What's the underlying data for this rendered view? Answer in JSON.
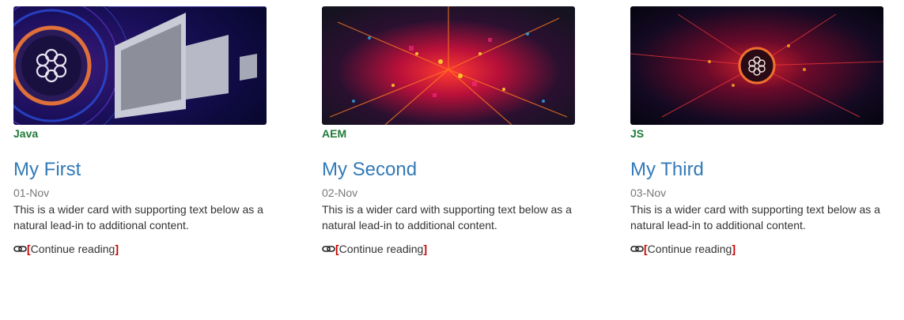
{
  "cards": [
    {
      "image_icon": "adobe-experience-manager-logo-with-tablets",
      "category": "Java",
      "title": "My First",
      "date": "01-Nov",
      "description": "This is a wider card with supporting text below as a natural lead-in to additional content.",
      "link_icon": "chain-link-icon",
      "read_more_open": "[",
      "read_more_label": "Continue reading",
      "read_more_close": "]"
    },
    {
      "image_icon": "circuit-board-red-lights",
      "category": "AEM",
      "title": "My Second",
      "date": "02-Nov",
      "description": "This is a wider card with supporting text below as a natural lead-in to additional content.",
      "link_icon": "chain-link-icon",
      "read_more_open": "[",
      "read_more_label": "Continue reading",
      "read_more_close": "]"
    },
    {
      "image_icon": "adobe-experience-manager-logo-on-circuit",
      "category": "JS",
      "title": "My Third",
      "date": "03-Nov",
      "description": "This is a wider card with supporting text below as a natural lead-in to additional content.",
      "link_icon": "chain-link-icon",
      "read_more_open": "[",
      "read_more_label": "Continue reading",
      "read_more_close": "]"
    }
  ],
  "colors": {
    "category": "#1f7a3a",
    "title": "#337ab7",
    "date": "#777777",
    "text": "#333333",
    "bracket": "#cc0000"
  }
}
